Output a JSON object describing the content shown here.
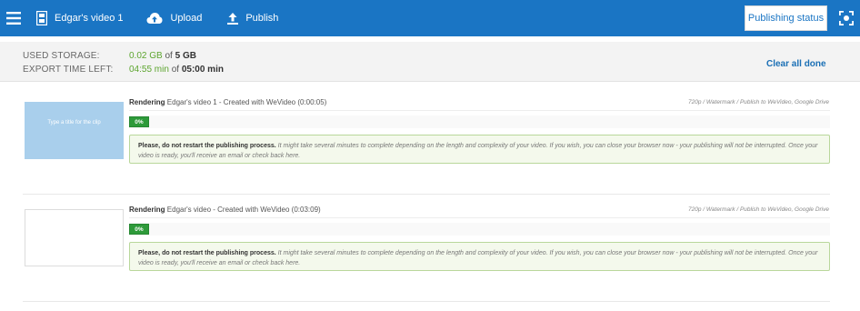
{
  "topbar": {
    "menu_icon": "hamburger-icon",
    "project_icon": "film-icon",
    "project_title": "Edgar's video 1",
    "upload_icon": "cloud-upload-icon",
    "upload_label": "Upload",
    "publish_icon": "upload-arrow-icon",
    "publish_label": "Publish",
    "publishing_status_label": "Publishing status",
    "focus_icon": "fullscreen-icon",
    "accent_color": "#1a75c4"
  },
  "summary": {
    "used_storage_label": "USED STORAGE:",
    "used_storage_value": "0.02 GB",
    "used_storage_of": "of",
    "used_storage_total": "5 GB",
    "export_time_label": "EXPORT TIME LEFT:",
    "export_time_value": "04:55 min",
    "export_time_of": "of",
    "export_time_total": "05:00 min",
    "clear_all_label": "Clear all done"
  },
  "renders": [
    {
      "thumbnail_text": "Type a title for the clip",
      "status": "Rendering",
      "title": "Edgar's video 1 - Created with WeVideo (0:00:05)",
      "meta": "720p / Watermark / Publish to WeVideo, Google Drive",
      "progress_label": "0%",
      "progress_percent": 0,
      "notice_strong": "Please, do not restart the publishing process.",
      "notice_text": "It might take several minutes to complete depending on the length and complexity of your video. If you wish, you can close your browser now - your publishing will not be interrupted. Once your video is ready, you'll receive an email or check back here."
    },
    {
      "thumbnail_text": "",
      "status": "Rendering",
      "title": "Edgar's video - Created with WeVideo (0:03:09)",
      "meta": "720p / Watermark / Publish to WeVideo, Google Drive",
      "progress_label": "0%",
      "progress_percent": 0,
      "notice_strong": "Please, do not restart the publishing process.",
      "notice_text": "It might take several minutes to complete depending on the length and complexity of your video. If you wish, you can close your browser now - your publishing will not be interrupted. Once your video is ready, you'll receive an email or check back here."
    }
  ],
  "colors": {
    "progress_green": "#2e9a3a",
    "value_green": "#5da52f",
    "notice_border": "#b9d79b"
  }
}
